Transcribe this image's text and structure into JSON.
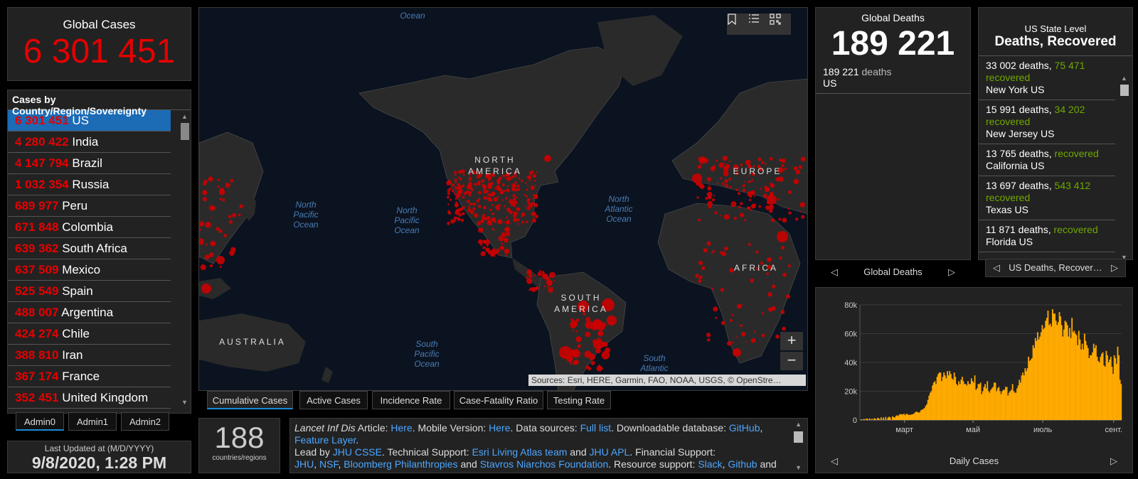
{
  "global_cases": {
    "title": "Global Cases",
    "value": "6 301 451"
  },
  "country_list": {
    "title": "Cases by Country/Region/Sovereignty",
    "items": [
      {
        "count": "6 301 451",
        "name": "US"
      },
      {
        "count": "4 280 422",
        "name": "India"
      },
      {
        "count": "4 147 794",
        "name": "Brazil"
      },
      {
        "count": "1 032 354",
        "name": "Russia"
      },
      {
        "count": "689 977",
        "name": "Peru"
      },
      {
        "count": "671 848",
        "name": "Colombia"
      },
      {
        "count": "639 362",
        "name": "South Africa"
      },
      {
        "count": "637 509",
        "name": "Mexico"
      },
      {
        "count": "525 549",
        "name": "Spain"
      },
      {
        "count": "488 007",
        "name": "Argentina"
      },
      {
        "count": "424 274",
        "name": "Chile"
      },
      {
        "count": "388 810",
        "name": "Iran"
      },
      {
        "count": "367 174",
        "name": "France"
      },
      {
        "count": "352 451",
        "name": "United Kingdom"
      }
    ]
  },
  "admin_tabs": [
    "Admin0",
    "Admin1",
    "Admin2"
  ],
  "last_updated": {
    "label": "Last Updated at (M/D/YYYY)",
    "value": "9/8/2020, 1:28 PM"
  },
  "map": {
    "attribution": "Sources: Esri, HERE, Garmin, FAO, NOAA, USGS, © OpenStre…",
    "oceans": [
      {
        "label": "Ocean"
      },
      {
        "label": "North Pacific Ocean"
      },
      {
        "label": "North Pacific Ocean"
      },
      {
        "label": "North Atlantic Ocean"
      },
      {
        "label": "South Pacific Ocean"
      },
      {
        "label": "South Atlantic"
      }
    ],
    "continents": [
      {
        "label": "NORTH AMERICA"
      },
      {
        "label": "SOUTH AMERICA"
      },
      {
        "label": "EUROPE"
      },
      {
        "label": "AFRICA"
      },
      {
        "label": "AUSTRALIA"
      }
    ],
    "zoom_in": "+",
    "zoom_out": "−",
    "tools": [
      "bookmark-icon",
      "list-icon",
      "qr-icon"
    ]
  },
  "map_tabs": [
    "Cumulative Cases",
    "Active Cases",
    "Incidence Rate",
    "Case-Fatality Ratio",
    "Testing Rate"
  ],
  "countries_count": {
    "value": "188",
    "label": "countries/regions"
  },
  "info": {
    "p1_italic": "Lancet Inf Dis",
    "p1_a": " Article: ",
    "here1": "Here",
    "p1_b": ". Mobile Version: ",
    "here2": "Here",
    "p1_c": ". Data sources: ",
    "full_list": "Full list",
    "p1_d": ". Downloadable database: ",
    "github": "GitHub",
    "p1_e": ",",
    "feature_layer": "Feature Layer",
    "p1_f": ".",
    "p2_a": "Lead by ",
    "jhu_csse": "JHU CSSE",
    "p2_b": ". Technical Support: ",
    "esri_atlas": "Esri Living Atlas team",
    "p2_c": " and ",
    "jhu_apl": "JHU APL",
    "p2_d": ". Financial Support:",
    "jhu": "JHU",
    "p3_a": ", ",
    "nsf": "NSF",
    "p3_b": ", ",
    "bloomberg": "Bloomberg Philanthropies",
    "p3_c": " and ",
    "snf": "Stavros Niarchos Foundation",
    "p3_d": ". Resource support: ",
    "slack": "Slack",
    "p3_e": ", ",
    "github2": "Github",
    "p3_f": " and"
  },
  "global_deaths": {
    "title": "Global Deaths",
    "value": "189 221",
    "detail_count": "189 221",
    "detail_label": " deaths",
    "detail_country": "US",
    "footer": "Global Deaths"
  },
  "us_state": {
    "title": "US State Level",
    "subtitle": "Deaths, Recovered",
    "items": [
      {
        "deaths": "33 002 deaths,",
        "recovered": "75 471",
        "recovered_label": "recovered",
        "state": "New York US"
      },
      {
        "deaths": "15 991 deaths,",
        "recovered": "34 202",
        "recovered_label": "recovered",
        "state": "New Jersey US"
      },
      {
        "deaths": "13 765 deaths,",
        "recovered": "",
        "recovered_label": "recovered",
        "state": "California US"
      },
      {
        "deaths": "13 697 deaths,",
        "recovered": "543 412",
        "recovered_label": "recovered",
        "state": "Texas US"
      },
      {
        "deaths": "11 871 deaths,",
        "recovered": "",
        "recovered_label": "recovered",
        "state": "Florida US"
      }
    ],
    "footer": "US Deaths, Recover…"
  },
  "colors": {
    "accent_red": "#e60000",
    "accent_green": "#70a800",
    "link_blue": "#4da6ff",
    "bar_orange": "#ffaa00",
    "selected_blue": "#1b6bb5"
  },
  "chart_data": {
    "type": "bar",
    "title": "",
    "footer": "Daily Cases",
    "xlabel": "",
    "ylabel": "",
    "ylim": [
      0,
      80000
    ],
    "y_ticks": [
      "0",
      "20k",
      "40k",
      "60k",
      "80k"
    ],
    "x_ticks": [
      "март",
      "май",
      "июль",
      "сент."
    ],
    "x_tick_positions": [
      39,
      99,
      160,
      222
    ],
    "color": "#ffaa00",
    "values": [
      0,
      500,
      0,
      800,
      0,
      900,
      1000,
      0,
      1100,
      0,
      800,
      0,
      1200,
      900,
      0,
      1500,
      1100,
      0,
      1900,
      0,
      1700,
      0,
      2100,
      0,
      1600,
      2300,
      1800,
      0,
      2600,
      2000,
      1700,
      2900,
      3300,
      2700,
      3800,
      4100,
      4000,
      3800,
      4400,
      3300,
      4300,
      4100,
      3600,
      3600,
      3700,
      3900,
      4100,
      4700,
      5500,
      5800,
      5500,
      5000,
      5700,
      6900,
      7200,
      7700,
      8300,
      9800,
      11000,
      14000,
      17000,
      19000,
      20000,
      24000,
      26000,
      27000,
      25000,
      30000,
      32000,
      33000,
      33000,
      27000,
      30000,
      33000,
      31000,
      29000,
      34000,
      31000,
      34000,
      32000,
      29000,
      28000,
      33000,
      30000,
      25000,
      24000,
      27000,
      25000,
      28000,
      30000,
      27000,
      25000,
      25000,
      24000,
      27000,
      25000,
      25000,
      29000,
      27000,
      26000,
      31000,
      21000,
      22000,
      25000,
      25000,
      26000,
      18000,
      20000,
      23000,
      25000,
      22000,
      27000,
      20000,
      19000,
      21000,
      22000,
      23000,
      26000,
      26000,
      20000,
      22000,
      23000,
      20000,
      18000,
      20000,
      21000,
      21000,
      23000,
      23000,
      17000,
      19000,
      20000,
      21000,
      25000,
      20000,
      19000,
      19000,
      22000,
      24000,
      28000,
      26000,
      31000,
      33000,
      31000,
      36000,
      34000,
      36000,
      44000,
      41000,
      42000,
      43000,
      52000,
      50000,
      57000,
      55000,
      61000,
      56000,
      58000,
      61000,
      66000,
      63000,
      64000,
      69000,
      71000,
      76000,
      66000,
      67000,
      65000,
      77000,
      74000,
      74000,
      69000,
      66000,
      68000,
      75000,
      72000,
      66000,
      58000,
      63000,
      69000,
      68000,
      66000,
      58000,
      64000,
      57000,
      71000,
      61000,
      62000,
      60000,
      59000,
      52000,
      62000,
      56000,
      49000,
      53000,
      49000,
      60000,
      55000,
      52000,
      50000,
      43000,
      45000,
      45000,
      47000,
      53000,
      50000,
      52000,
      44000,
      41000,
      40000,
      44000,
      46000,
      47000,
      38000,
      37000,
      48000,
      45000,
      40000,
      42000,
      44000,
      37000,
      32000,
      45000,
      43000,
      39000,
      51000,
      45000,
      28000,
      25000
    ]
  }
}
